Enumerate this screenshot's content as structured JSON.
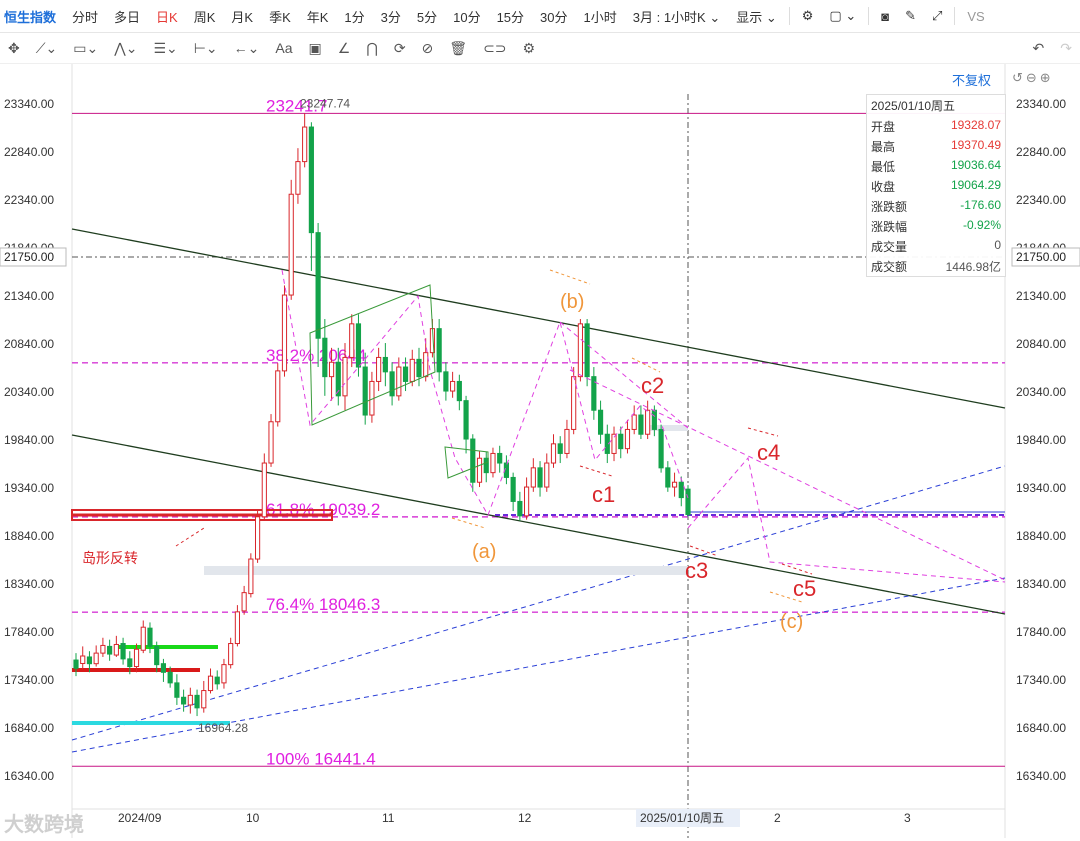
{
  "toolbar": {
    "brand": "恒生指数",
    "periods": [
      "分时",
      "多日",
      "日K",
      "周K",
      "月K",
      "季K",
      "年K",
      "1分",
      "3分",
      "5分",
      "10分",
      "15分",
      "30分",
      "1小时"
    ],
    "active_period": "日K",
    "period_dropdown": "3月 : 1小时K",
    "display": "显示",
    "vs": "VS"
  },
  "tools": [
    "crosshair-icon",
    "line-tool-icon",
    "rect-tool-icon",
    "wave-tool-icon",
    "fib-tool-icon",
    "measure-tool-icon",
    "arrow-tool-icon",
    "text-tool-icon",
    "comment-tool-icon",
    "pen-tool-icon",
    "arc-tool-icon",
    "cycle-tool-icon",
    "hide-tool-icon",
    "trash-tool-icon",
    "link-tool-icon",
    "settings-tool-icon"
  ],
  "fq_label": "不复权",
  "info": {
    "date": "2025/01/10周五",
    "rows": [
      {
        "k": "开盘",
        "v": "19328.07",
        "c": "#e53935"
      },
      {
        "k": "最高",
        "v": "19370.49",
        "c": "#e53935"
      },
      {
        "k": "最低",
        "v": "19036.64",
        "c": "#13a34a"
      },
      {
        "k": "收盘",
        "v": "19064.29",
        "c": "#13a34a"
      },
      {
        "k": "涨跌额",
        "v": "-176.60",
        "c": "#13a34a"
      },
      {
        "k": "涨跌幅",
        "v": "-0.92%",
        "c": "#13a34a"
      },
      {
        "k": "成交量",
        "v": "0",
        "c": "#555"
      },
      {
        "k": "成交额",
        "v": "1446.98亿",
        "c": "#555"
      }
    ]
  },
  "watermark": "大数跨境",
  "chart_data": {
    "type": "candlestick",
    "y_ticks": [
      23340,
      22840,
      22340,
      21840,
      21340,
      20840,
      20340,
      19840,
      19340,
      18840,
      18340,
      17840,
      17340,
      16840,
      16340
    ],
    "ylim": [
      16220,
      23470
    ],
    "crosshair_price": "21750.00",
    "x_labels": [
      "2024/09",
      "10",
      "11",
      "12",
      "2025/01/10周五",
      "2",
      "3"
    ],
    "candles": [
      [
        17548,
        17462,
        17620,
        17380
      ],
      [
        17512,
        17590,
        17690,
        17450
      ],
      [
        17580,
        17510,
        17640,
        17420
      ],
      [
        17510,
        17620,
        17700,
        17480
      ],
      [
        17620,
        17700,
        17780,
        17580
      ],
      [
        17690,
        17610,
        17760,
        17540
      ],
      [
        17600,
        17710,
        17800,
        17580
      ],
      [
        17720,
        17560,
        17780,
        17500
      ],
      [
        17560,
        17480,
        17640,
        17400
      ],
      [
        17480,
        17660,
        17720,
        17420
      ],
      [
        17650,
        17890,
        17960,
        17620
      ],
      [
        17880,
        17690,
        17940,
        17620
      ],
      [
        17690,
        17500,
        17740,
        17420
      ],
      [
        17510,
        17420,
        17560,
        17320
      ],
      [
        17420,
        17310,
        17480,
        17260
      ],
      [
        17310,
        17160,
        17400,
        17080
      ],
      [
        17160,
        17090,
        17240,
        17010
      ],
      [
        17080,
        17180,
        17260,
        16990
      ],
      [
        17180,
        17050,
        17240,
        16964.28
      ],
      [
        17050,
        17230,
        17330,
        17000
      ],
      [
        17230,
        17380,
        17460,
        17200
      ],
      [
        17370,
        17300,
        17440,
        17240
      ],
      [
        17310,
        17500,
        17560,
        17250
      ],
      [
        17500,
        17720,
        17780,
        17460
      ],
      [
        17720,
        18050,
        18120,
        17690
      ],
      [
        18060,
        18250,
        18320,
        18020
      ],
      [
        18240,
        18600,
        18660,
        18200
      ],
      [
        18600,
        19040,
        19120,
        18560
      ],
      [
        19040,
        19600,
        19700,
        19000
      ],
      [
        19600,
        20030,
        20110,
        19560
      ],
      [
        20030,
        20560,
        20640,
        19980
      ],
      [
        20560,
        21350,
        21450,
        20500
      ],
      [
        21350,
        22400,
        22550,
        21300
      ],
      [
        22400,
        22740,
        22880,
        22300
      ],
      [
        22740,
        23100,
        23241.74,
        22680
      ],
      [
        23100,
        22000,
        23150,
        21600
      ],
      [
        22000,
        20900,
        22100,
        20600
      ],
      [
        20900,
        20500,
        21100,
        20300
      ],
      [
        20500,
        20650,
        20800,
        20250
      ],
      [
        20650,
        20300,
        20800,
        20200
      ],
      [
        20300,
        20700,
        20850,
        20150
      ],
      [
        20700,
        21050,
        21150,
        20600
      ],
      [
        21050,
        20600,
        21150,
        20500
      ],
      [
        20600,
        20100,
        20750,
        20000
      ],
      [
        20100,
        20450,
        20550,
        20020
      ],
      [
        20450,
        20700,
        20800,
        20350
      ],
      [
        20700,
        20550,
        20850,
        20400
      ],
      [
        20550,
        20300,
        20650,
        20200
      ],
      [
        20300,
        20600,
        20700,
        20250
      ],
      [
        20600,
        20450,
        20700,
        20350
      ],
      [
        20450,
        20680,
        20780,
        20400
      ],
      [
        20680,
        20500,
        20800,
        20400
      ],
      [
        20500,
        20750,
        20900,
        20450
      ],
      [
        20750,
        21000,
        21100,
        20700
      ],
      [
        21000,
        20550,
        21100,
        20450
      ],
      [
        20550,
        20350,
        20650,
        20250
      ],
      [
        20350,
        20450,
        20550,
        20280
      ],
      [
        20450,
        20250,
        20520,
        20150
      ],
      [
        20250,
        19850,
        20300,
        19700
      ],
      [
        19850,
        19400,
        19900,
        19300
      ],
      [
        19400,
        19650,
        19720,
        19350
      ],
      [
        19650,
        19500,
        19720,
        19400
      ],
      [
        19500,
        19700,
        19760,
        19450
      ],
      [
        19700,
        19600,
        19780,
        19500
      ],
      [
        19600,
        19450,
        19680,
        19380
      ],
      [
        19450,
        19200,
        19500,
        19100
      ],
      [
        19200,
        19050,
        19300,
        19000
      ],
      [
        19050,
        19350,
        19450,
        19010
      ],
      [
        19350,
        19550,
        19650,
        19300
      ],
      [
        19550,
        19350,
        19620,
        19250
      ],
      [
        19350,
        19600,
        19700,
        19300
      ],
      [
        19600,
        19800,
        19900,
        19550
      ],
      [
        19800,
        19700,
        19880,
        19600
      ],
      [
        19700,
        19950,
        20050,
        19650
      ],
      [
        19950,
        20500,
        20600,
        19900
      ],
      [
        20500,
        21050,
        21100,
        20450
      ],
      [
        21050,
        20500,
        21100,
        20400
      ],
      [
        20500,
        20150,
        20600,
        20050
      ],
      [
        20150,
        19900,
        20250,
        19800
      ],
      [
        19900,
        19700,
        20000,
        19600
      ],
      [
        19700,
        19900,
        19980,
        19620
      ],
      [
        19900,
        19750,
        19980,
        19650
      ],
      [
        19750,
        19950,
        20050,
        19700
      ],
      [
        19950,
        20100,
        20200,
        19900
      ],
      [
        20100,
        19900,
        20200,
        19850
      ],
      [
        19900,
        20150,
        20250,
        19850
      ],
      [
        20150,
        19950,
        20200,
        19880
      ],
      [
        19950,
        19550,
        20000,
        19500
      ],
      [
        19550,
        19350,
        19620,
        19300
      ],
      [
        19350,
        19400,
        19500,
        19250
      ],
      [
        19400,
        19240,
        19460,
        19150
      ],
      [
        19328.07,
        19064.29,
        19370.49,
        19036.64
      ]
    ],
    "levels": [
      {
        "label": "23241.7",
        "price": 23241.7,
        "color": "#c71585"
      },
      {
        "label": "38.2% 20644",
        "price": 20644,
        "color": "#d63ad6"
      },
      {
        "label": "61.8% 19039.2",
        "price": 19039.2,
        "color": "#d63ad6"
      },
      {
        "label": "76.4% 18046.3",
        "price": 18046.3,
        "color": "#d63ad6"
      },
      {
        "label": "100% 16441.4",
        "price": 16441.4,
        "color": "#c71585"
      }
    ],
    "high_label": "23247.74",
    "low_label": "16964.28",
    "annotations": [
      {
        "text": "(b)",
        "color": "#f0963a"
      },
      {
        "text": "(a)",
        "color": "#f0963a"
      },
      {
        "text": "(c)",
        "color": "#f0963a"
      },
      {
        "text": "c1",
        "color": "#d9262b"
      },
      {
        "text": "c2",
        "color": "#d9262b"
      },
      {
        "text": "c3",
        "color": "#d9262b"
      },
      {
        "text": "c4",
        "color": "#d9262b"
      },
      {
        "text": "c5",
        "color": "#d9262b"
      },
      {
        "text": "岛形反转",
        "color": "#d9262b"
      }
    ]
  }
}
